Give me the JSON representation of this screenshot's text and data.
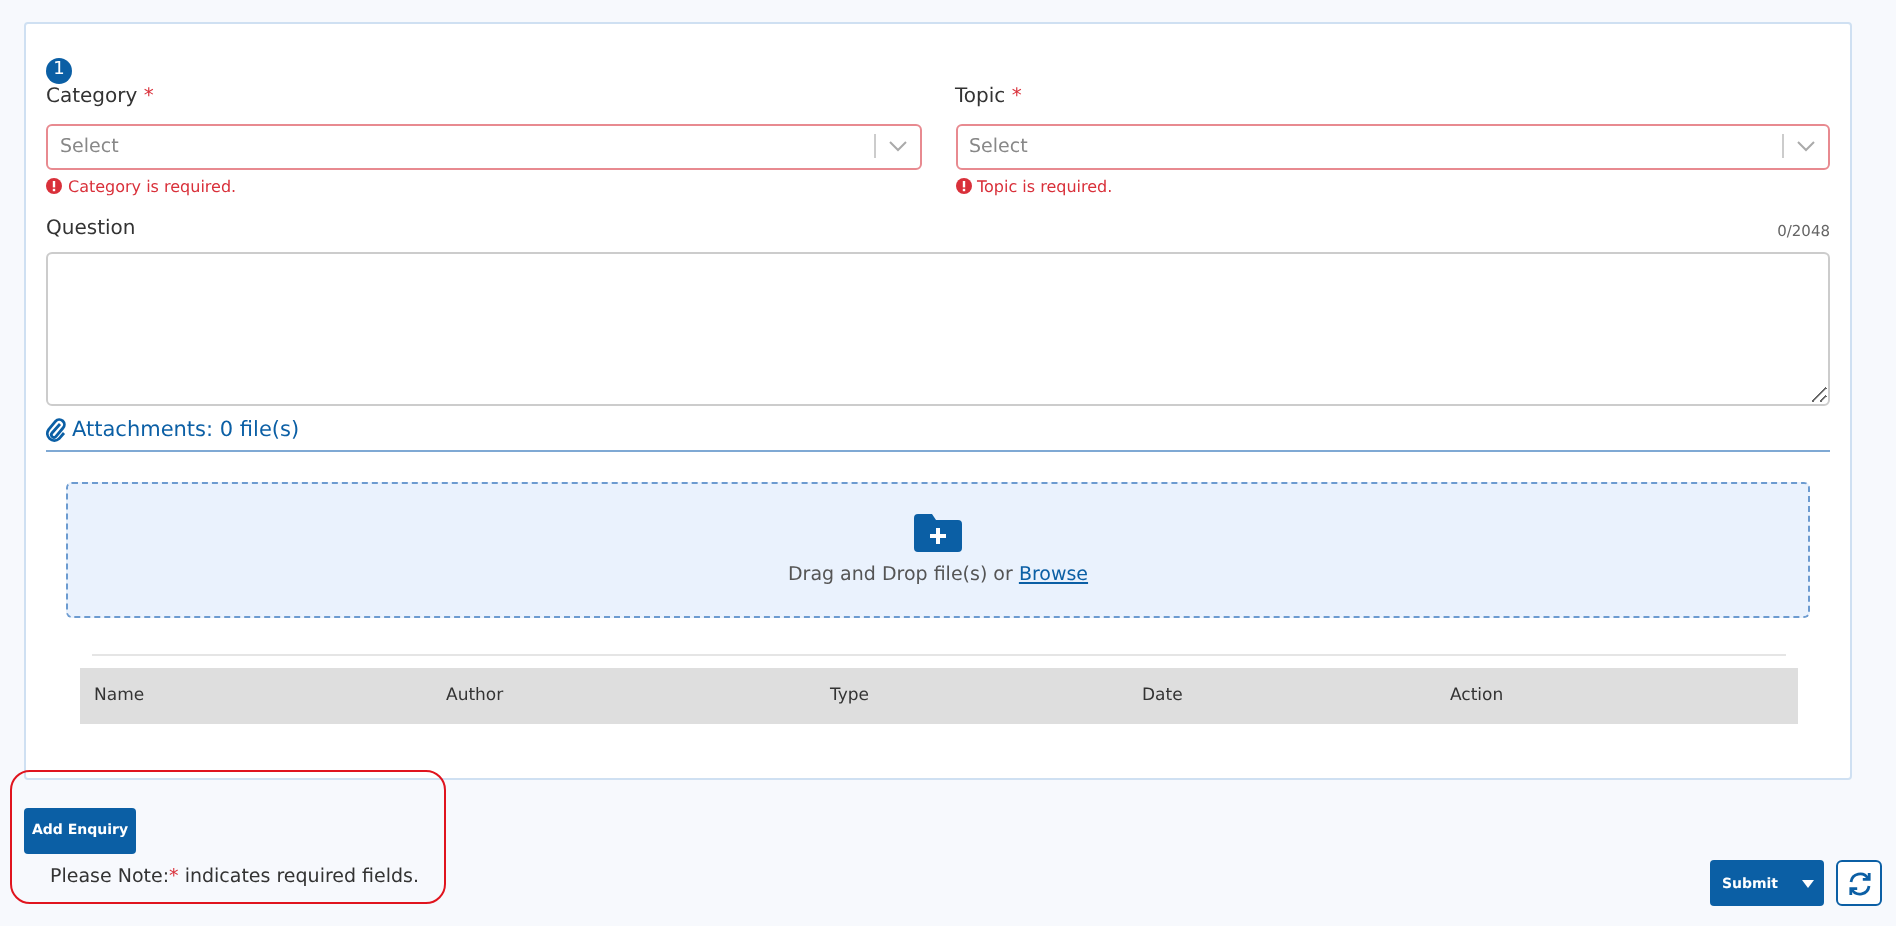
{
  "step": "1",
  "fields": [
    {
      "label": "Category",
      "required_mark": "*",
      "placeholder": "Select",
      "error": "Category is required.",
      "invalid": true
    },
    {
      "label": "Topic",
      "required_mark": "*",
      "placeholder": "Select",
      "error": "Topic is required.",
      "invalid": true
    }
  ],
  "question": {
    "label": "Question",
    "counter": "0/2048"
  },
  "attachments": {
    "title": "Attachments: 0 file(s)",
    "drop_text": "Drag and Drop file(s) or",
    "browse": "Browse"
  },
  "table": {
    "columns": [
      "Name",
      "Author",
      "Type",
      "Date",
      "Action"
    ]
  },
  "add_button": "Add Enquiry",
  "note": {
    "prefix": "Please Note:",
    "mark": "*",
    "text": " indicates required fields."
  },
  "submit": "Submit"
}
